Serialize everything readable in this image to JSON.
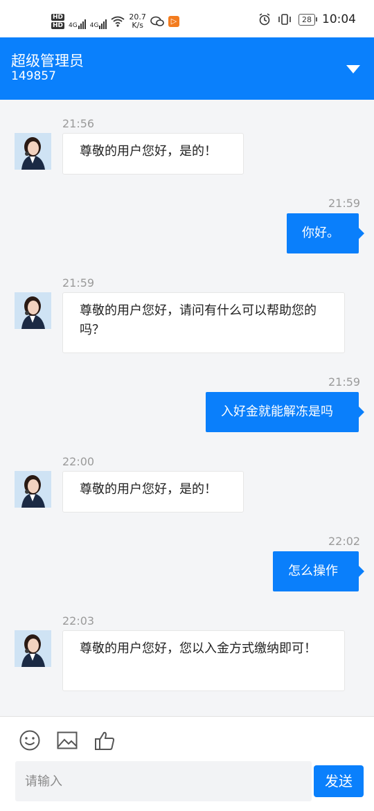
{
  "status_bar": {
    "hd1": "HD",
    "hd2": "HD",
    "net1": "4G",
    "net2": "4G",
    "speed_value": "20.7",
    "speed_unit": "K/s",
    "battery": "28",
    "time": "10:04"
  },
  "header": {
    "title": "超级管理员",
    "id": "149857"
  },
  "messages": [
    {
      "time": "21:56",
      "text": "尊敬的用户您好，是的！"
    },
    {
      "time": "21:59",
      "text": "你好。"
    },
    {
      "time": "21:59",
      "text": "尊敬的用户您好，请问有什么可以帮助您的吗？"
    },
    {
      "time": "21:59",
      "text": "入好金就能解冻是吗"
    },
    {
      "time": "22:00",
      "text": "尊敬的用户您好，是的！"
    },
    {
      "time": "22:02",
      "text": "怎么操作"
    },
    {
      "time": "22:03",
      "text": "尊敬的用户您好，您以入金方式缴纳即可！"
    }
  ],
  "composer": {
    "placeholder": "请输入",
    "send_label": "发送"
  },
  "icons": [
    "emoji-icon",
    "image-icon",
    "thumbs-up-icon"
  ],
  "colors": {
    "accent": "#0a80fc",
    "outgoing_bubble": "#0a7ffb",
    "background": "#f4f5f7"
  }
}
